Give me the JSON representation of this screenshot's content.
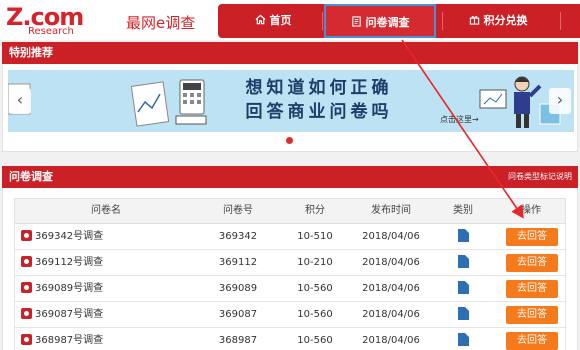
{
  "brand": {
    "logo": "Z.com",
    "logo_sub": "Research",
    "site_name": "最网e调查"
  },
  "nav": {
    "items": [
      {
        "label": "首页",
        "icon": "home-icon"
      },
      {
        "label": "问卷调查",
        "icon": "survey-icon",
        "active": true
      },
      {
        "label": "积分兑换",
        "icon": "gift-icon"
      }
    ]
  },
  "featured": {
    "title": "特别推荐",
    "banner_text_line1": "想知道如何正确",
    "banner_text_line2": "回答商业问卷吗",
    "banner_link": "点击这里→",
    "prev_icon": "chevron-left-icon",
    "next_icon": "chevron-right-icon"
  },
  "surveys": {
    "title": "问卷调查",
    "legend_link": "问卷类型标记说明",
    "columns": [
      "问卷名",
      "问卷号",
      "积分",
      "发布时间",
      "类别",
      "操作"
    ],
    "rows": [
      {
        "name": "369342号调查",
        "id": "369342",
        "points": "10-510",
        "date": "2018/04/06",
        "action": "去回答"
      },
      {
        "name": "369112号调查",
        "id": "369112",
        "points": "10-210",
        "date": "2018/04/06",
        "action": "去回答"
      },
      {
        "name": "369089号调查",
        "id": "369089",
        "points": "10-560",
        "date": "2018/04/06",
        "action": "去回答"
      },
      {
        "name": "369087号调查",
        "id": "369087",
        "points": "10-560",
        "date": "2018/04/06",
        "action": "去回答"
      },
      {
        "name": "368987号调查",
        "id": "368987",
        "points": "10-560",
        "date": "2018/04/06",
        "action": "去回答"
      }
    ]
  },
  "colors": {
    "brand_red": "#cc2027",
    "button_orange": "#f57a1c",
    "banner_bg": "#bce2f3",
    "highlight_blue": "#4a90d9"
  }
}
